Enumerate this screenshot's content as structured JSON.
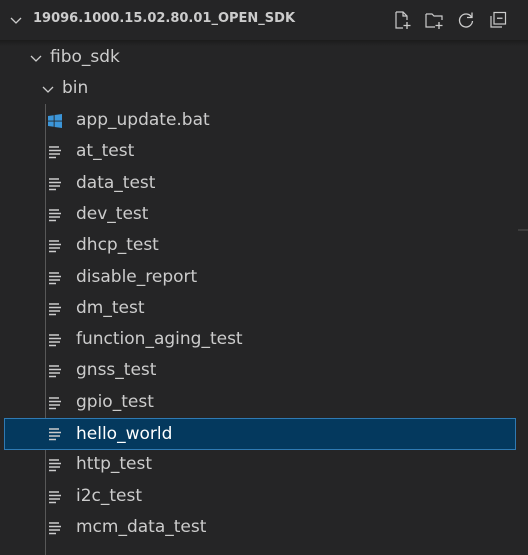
{
  "explorer": {
    "section_title": "19096.1000.15.02.80.01_OPEN_SDK",
    "actions": [
      {
        "name": "new-file-icon"
      },
      {
        "name": "new-folder-icon"
      },
      {
        "name": "refresh-icon"
      },
      {
        "name": "collapse-all-icon"
      }
    ],
    "tree": {
      "root_folder": "fibo_sdk",
      "sub_folder": "bin",
      "files": [
        {
          "label": "app_update.bat",
          "icon": "windows-icon"
        },
        {
          "label": "at_test",
          "icon": "text-file-icon"
        },
        {
          "label": "data_test",
          "icon": "text-file-icon"
        },
        {
          "label": "dev_test",
          "icon": "text-file-icon"
        },
        {
          "label": "dhcp_test",
          "icon": "text-file-icon"
        },
        {
          "label": "disable_report",
          "icon": "text-file-icon"
        },
        {
          "label": "dm_test",
          "icon": "text-file-icon"
        },
        {
          "label": "function_aging_test",
          "icon": "text-file-icon"
        },
        {
          "label": "gnss_test",
          "icon": "text-file-icon"
        },
        {
          "label": "gpio_test",
          "icon": "text-file-icon"
        },
        {
          "label": "hello_world",
          "icon": "text-file-icon",
          "selected": true
        },
        {
          "label": "http_test",
          "icon": "text-file-icon"
        },
        {
          "label": "i2c_test",
          "icon": "text-file-icon"
        },
        {
          "label": "mcm_data_test",
          "icon": "text-file-icon"
        }
      ]
    }
  },
  "colors": {
    "background": "#252526",
    "text": "#cccccc",
    "selection_bg": "#04395e",
    "selection_border": "#2f7ab3",
    "windows_icon": "#3c96d9"
  }
}
